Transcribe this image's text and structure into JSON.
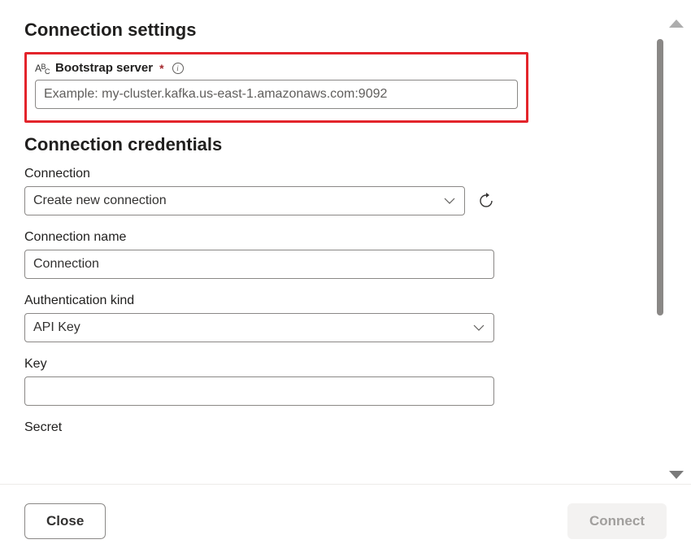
{
  "sections": {
    "connection_settings": {
      "heading": "Connection settings",
      "bootstrap_server": {
        "label": "Bootstrap server",
        "required": true,
        "placeholder": "Example: my-cluster.kafka.us-east-1.amazonaws.com:9092",
        "value": ""
      }
    },
    "connection_credentials": {
      "heading": "Connection credentials",
      "connection": {
        "label": "Connection",
        "value": "Create new connection"
      },
      "connection_name": {
        "label": "Connection name",
        "value": "Connection"
      },
      "authentication_kind": {
        "label": "Authentication kind",
        "value": "API Key"
      },
      "key": {
        "label": "Key",
        "value": ""
      },
      "secret": {
        "label": "Secret",
        "value": ""
      }
    }
  },
  "footer": {
    "close_label": "Close",
    "connect_label": "Connect"
  }
}
